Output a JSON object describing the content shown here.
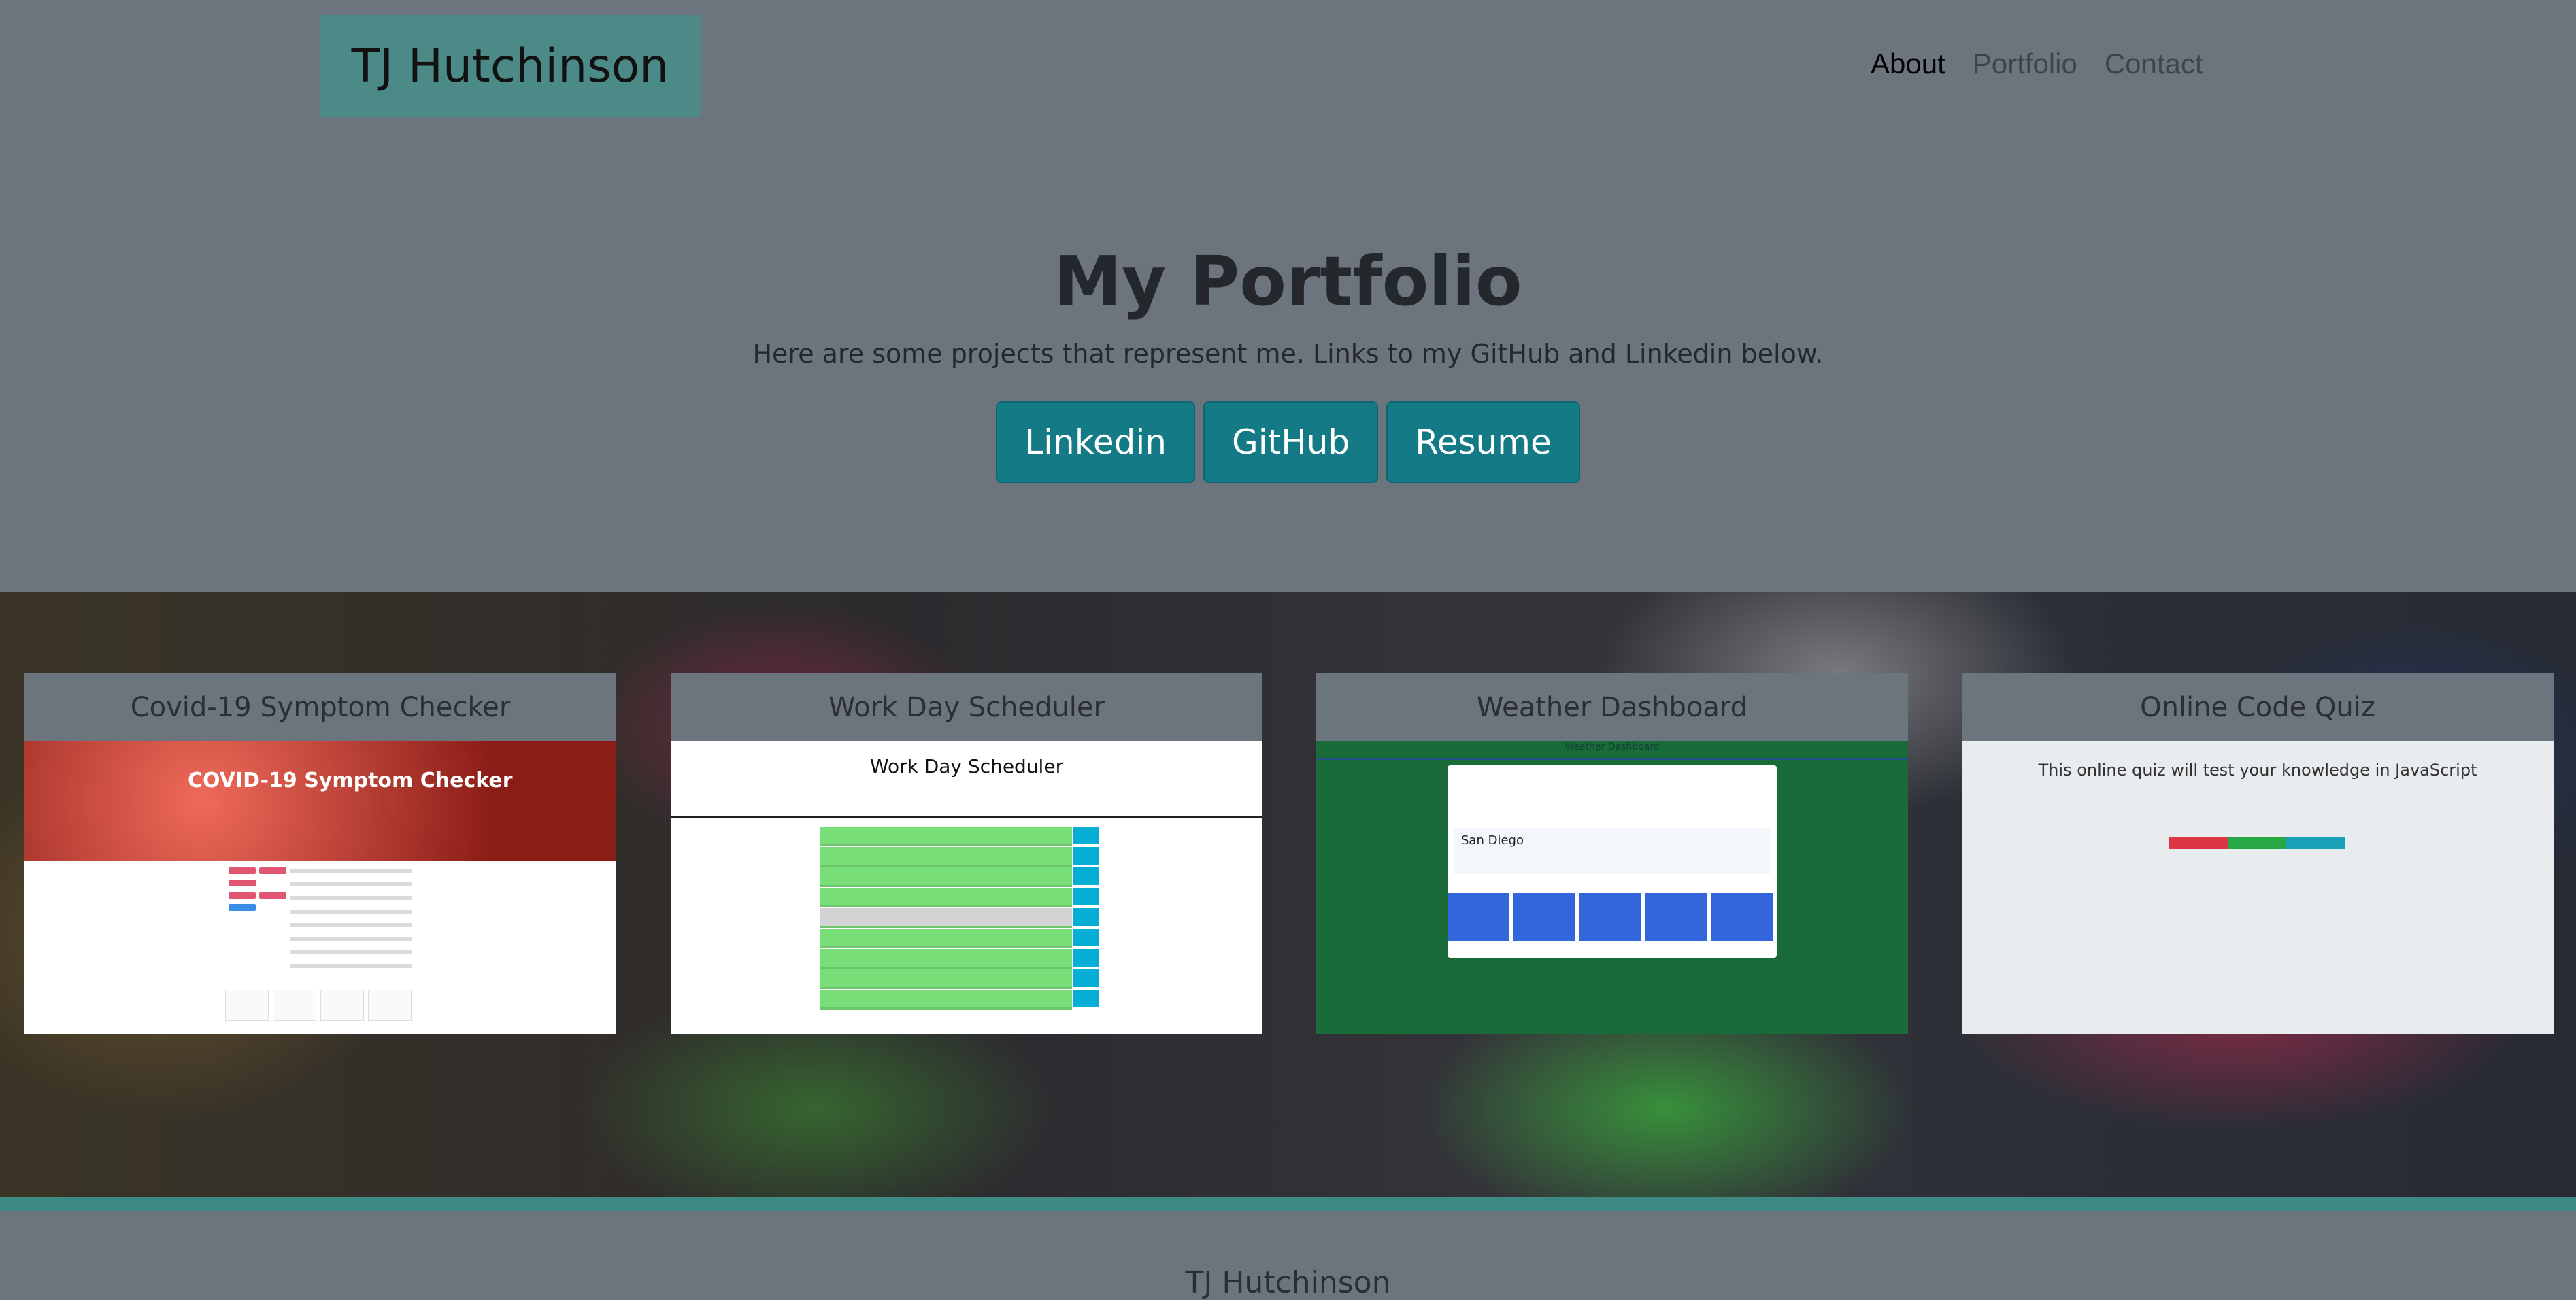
{
  "header": {
    "brand": "TJ Hutchinson",
    "nav": [
      {
        "label": "About",
        "active": true
      },
      {
        "label": "Portfolio",
        "active": false
      },
      {
        "label": "Contact",
        "active": false
      }
    ]
  },
  "hero": {
    "title": "My Portfolio",
    "subtitle": "Here are some projects that represent me. Links to my GitHub and Linkedin below.",
    "buttons": [
      "Linkedin",
      "GitHub",
      "Resume"
    ]
  },
  "projects": [
    {
      "title": "Covid-19 Symptom Checker",
      "shot_heading": "COVID-19 Symptom Checker"
    },
    {
      "title": "Work Day Scheduler",
      "shot_heading": "Work Day Scheduler"
    },
    {
      "title": "Weather Dashboard",
      "shot_heading": "Weather Dashboard",
      "city": "San Diego"
    },
    {
      "title": "Online Code Quiz",
      "shot_heading": "This online quiz will test your knowledge in JavaScript"
    }
  ],
  "footer": {
    "text": "TJ Hutchinson"
  },
  "colors": {
    "background": "#6c757d",
    "brand_bg": "#4b8a86",
    "button": "#147a85",
    "accent_bar": "#3d8a85"
  }
}
